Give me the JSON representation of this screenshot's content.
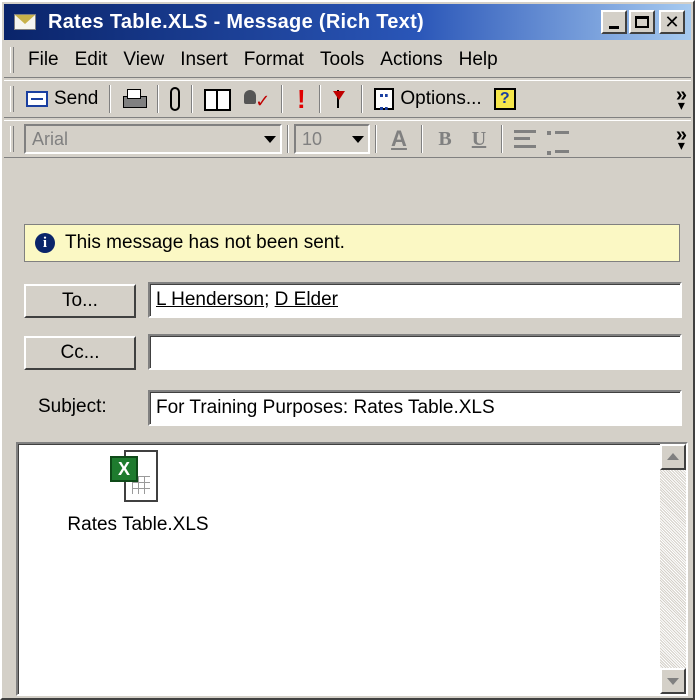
{
  "window": {
    "title": "Rates Table.XLS - Message (Rich Text)",
    "controls": [
      "minimize",
      "maximize",
      "close"
    ]
  },
  "menubar": {
    "items": [
      {
        "label": "File"
      },
      {
        "label": "Edit"
      },
      {
        "label": "View"
      },
      {
        "label": "Insert"
      },
      {
        "label": "Format"
      },
      {
        "label": "Tools"
      },
      {
        "label": "Actions"
      },
      {
        "label": "Help"
      }
    ]
  },
  "toolbar1": {
    "send_label": "Send",
    "options_label": "Options...",
    "icons": [
      "send-icon",
      "print-icon",
      "paperclip-icon",
      "address-book-icon",
      "check-names-icon",
      "importance-high-icon",
      "flag-icon",
      "options-icon",
      "help-icon",
      "chevron-more-icon"
    ]
  },
  "toolbar2": {
    "font": "Arial",
    "size": "10",
    "icons": [
      "font-color-icon",
      "bold-icon",
      "underline-icon",
      "align-left-icon",
      "bullets-icon",
      "chevron-more-icon"
    ]
  },
  "info": {
    "message": "This message has not been sent."
  },
  "to": {
    "button_label": "To...",
    "recipients": [
      "L Henderson",
      "D Elder"
    ],
    "separator": "; "
  },
  "cc": {
    "button_label": "Cc...",
    "value": ""
  },
  "subject": {
    "label": "Subject:",
    "value": "For Training Purposes: Rates Table.XLS"
  },
  "body": {
    "attachment_name": "Rates Table.XLS"
  },
  "colors": {
    "titlebar_start": "#0a246a",
    "titlebar_end": "#a6caf0",
    "infobar_bg": "#fbf8c4",
    "excel_green": "#1e7b2e"
  }
}
